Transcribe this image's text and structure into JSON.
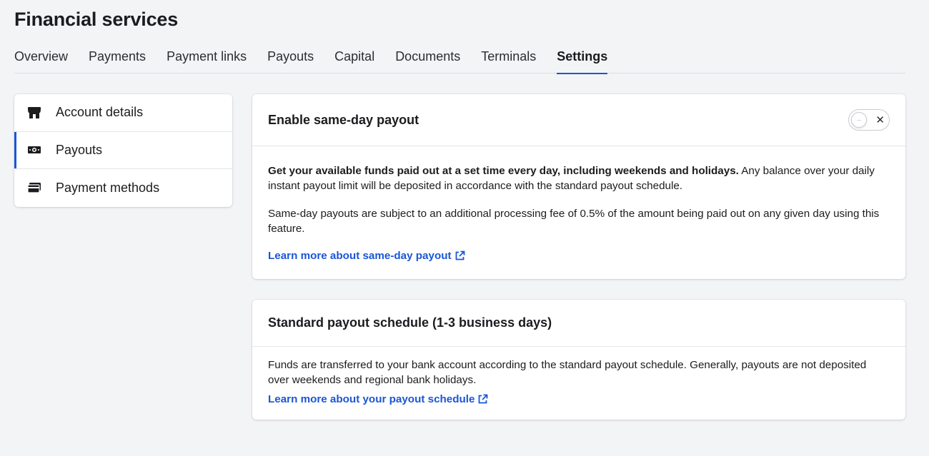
{
  "page": {
    "title": "Financial services"
  },
  "tabs": [
    {
      "label": "Overview"
    },
    {
      "label": "Payments"
    },
    {
      "label": "Payment links"
    },
    {
      "label": "Payouts"
    },
    {
      "label": "Capital"
    },
    {
      "label": "Documents"
    },
    {
      "label": "Terminals"
    },
    {
      "label": "Settings",
      "active": true
    }
  ],
  "sidebar": {
    "items": [
      {
        "label": "Account details",
        "icon": "store-icon"
      },
      {
        "label": "Payouts",
        "icon": "cash-icon",
        "active": true
      },
      {
        "label": "Payment methods",
        "icon": "card-icon"
      }
    ]
  },
  "same_day": {
    "title": "Enable same-day payout",
    "toggle": {
      "state": "off",
      "off_symbol": "✕",
      "knob_symbol": "···"
    },
    "para1_bold": "Get your available funds paid out at a set time every day, including weekends and holidays.",
    "para1_rest": " Any balance over your daily instant payout limit will be deposited in accordance with the standard payout schedule.",
    "para2": "Same-day payouts are subject to an additional processing fee of 0.5% of the amount being paid out on any given day using this feature.",
    "link": "Learn more about same-day payout"
  },
  "standard": {
    "title": "Standard payout schedule (1-3 business days)",
    "para": "Funds are transferred to your bank account according to the standard payout schedule. Generally, payouts are not deposited over weekends and regional bank holidays.",
    "link": "Learn more about your payout schedule"
  },
  "colors": {
    "accent": "#1a56d6",
    "background": "#f3f4f6",
    "card": "#ffffff"
  }
}
